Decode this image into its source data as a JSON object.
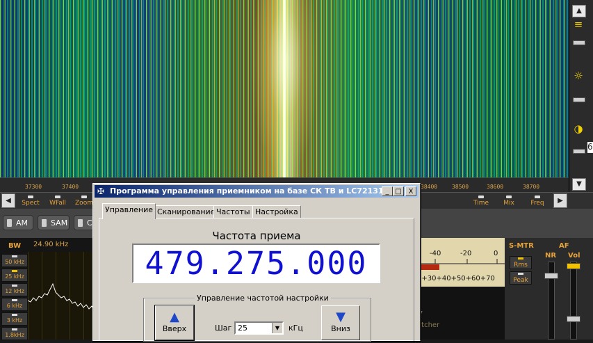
{
  "waterfall": {
    "ruler_labels": [
      "37300",
      "37400",
      "38400",
      "38500",
      "38600",
      "38700"
    ]
  },
  "right_strip": {
    "edge_text": "6"
  },
  "toolbar": {
    "left_buttons": [
      "Spect",
      "WFall",
      "Zoom"
    ],
    "right_buttons": [
      "Time",
      "Mix",
      "Freq"
    ]
  },
  "modes": [
    "AM",
    "SAM",
    "CW"
  ],
  "bw": {
    "title": "BW",
    "value": "24.90 kHz",
    "buttons": [
      "50 kHz",
      "25 kHz",
      "12 kHz",
      "6 kHz",
      "3 kHz",
      "1.8kHz"
    ]
  },
  "smeter": {
    "top_scale": [
      "-40",
      "-20",
      "0"
    ],
    "bottom_scale": "0+30+40+50+60+70",
    "lower_texts": [
      "l",
      "7",
      "etcher"
    ]
  },
  "smtr": {
    "title": "S-MTR",
    "buttons": [
      "Rms",
      "Peak"
    ]
  },
  "af": {
    "title": "AF",
    "labels": [
      "NR",
      "Vol"
    ]
  },
  "dialog": {
    "title": "Программа управления приемником на базе СК ТВ и LC72131",
    "caption_buttons": [
      "_",
      "□",
      "X"
    ],
    "tabs": [
      "Управление",
      "Сканирование",
      "Частоты",
      "Настройка"
    ],
    "frequency_title": "Частота приема",
    "frequency_value": "479.275.000",
    "group_title": "Управление частотой настройки",
    "up_label": "Вверх",
    "down_label": "Вниз",
    "step_label": "Шаг",
    "step_value": "25",
    "step_unit": "кГц"
  },
  "colors": {
    "accent": "#e6a33a",
    "titlebar": "#0a246a",
    "digits": "#1010d0"
  }
}
